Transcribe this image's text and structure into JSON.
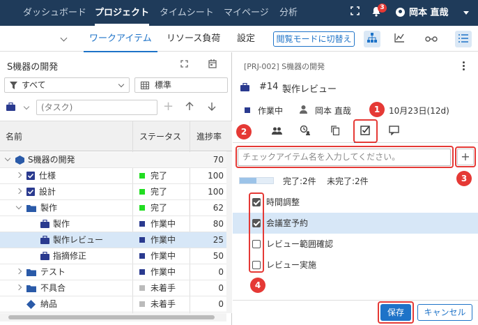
{
  "topnav": {
    "tabs": [
      "ダッシュボード",
      "プロジェクト",
      "タイムシート",
      "マイページ",
      "分析"
    ],
    "notifications": "3",
    "user": "岡本 直哉"
  },
  "subnav": {
    "tabs": [
      "ワークアイテム",
      "リソース負荷",
      "設定"
    ],
    "view_mode_button": "閲覧モードに切替え"
  },
  "left": {
    "title": "S機器の開発",
    "filter_all": "すべて",
    "filter_view": "標準",
    "task_placeholder": "(タスク)",
    "headers": {
      "name": "名前",
      "status": "ステータス",
      "progress": "進捗率"
    },
    "rows": [
      {
        "name": "S機器の開発",
        "status": "",
        "progress": "70"
      },
      {
        "name": "仕様",
        "status": "完了",
        "progress": "100"
      },
      {
        "name": "設計",
        "status": "完了",
        "progress": "100"
      },
      {
        "name": "製作",
        "status": "完了",
        "progress": "62"
      },
      {
        "name": "製作",
        "status": "作業中",
        "progress": "80"
      },
      {
        "name": "製作レビュー",
        "status": "作業中",
        "progress": "25"
      },
      {
        "name": "指摘修正",
        "status": "作業中",
        "progress": "50"
      },
      {
        "name": "テスト",
        "status": "作業中",
        "progress": "0"
      },
      {
        "name": "不具合",
        "status": "未着手",
        "progress": "0"
      },
      {
        "name": "納品",
        "status": "未着手",
        "progress": "0"
      }
    ],
    "status_colors": {
      "完了": "#22dd22",
      "作業中": "#2a3a8f",
      "未着手": "#bbbbbb"
    }
  },
  "right": {
    "breadcrumb": "[PRJ-002] S機器の開発",
    "item_number": "#14",
    "item_title": "製作レビュー",
    "status": "作業中",
    "assignee": "岡本 直哉",
    "date": "10月23日(12d)",
    "check_placeholder": "チェックアイテム名を入力してください。",
    "summary_done": "完了:2件",
    "summary_todo": "未完了:2件",
    "checklist": [
      {
        "label": "時間調整",
        "checked": true
      },
      {
        "label": "会議室予約",
        "checked": true
      },
      {
        "label": "レビュー範囲確認",
        "checked": false
      },
      {
        "label": "レビュー実施",
        "checked": false
      }
    ],
    "save": "保存",
    "cancel": "キャンセル"
  },
  "markers": [
    "1",
    "2",
    "3",
    "4"
  ]
}
